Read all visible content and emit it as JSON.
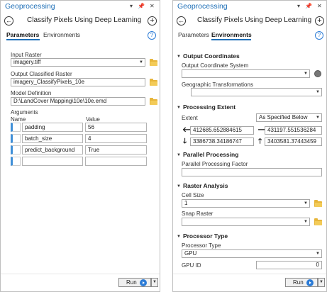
{
  "left": {
    "window": {
      "title": "Geoprocessing",
      "pin": "▾ ⊞ ✕"
    },
    "header": {
      "back": "←",
      "tool_title": "Classify Pixels Using Deep Learning",
      "add": "+"
    },
    "tabs": {
      "parameters": "Parameters",
      "environments": "Environments",
      "help": "?"
    },
    "input_raster": {
      "label": "Input Raster",
      "value": "imagery.tiff"
    },
    "output_raster": {
      "label": "Output Classified Raster",
      "value": "imagery_ClassifyPixels_10e"
    },
    "model_definition": {
      "label": "Model Definition",
      "value": "D:\\LandCover Mapping\\10e\\10e.emd"
    },
    "arguments": {
      "label": "Arguments",
      "col_name": "Name",
      "col_value": "Value",
      "rows": [
        {
          "name": "padding",
          "value": "56"
        },
        {
          "name": "batch_size",
          "value": "4"
        },
        {
          "name": "predict_background",
          "value": "True"
        },
        {
          "name": "",
          "value": ""
        }
      ]
    },
    "run": {
      "label": "Run"
    }
  },
  "right": {
    "window": {
      "title": "Geoprocessing",
      "pin": "▾ ⊞ ✕"
    },
    "header": {
      "back": "←",
      "tool_title": "Classify Pixels Using Deep Learning",
      "add": "+"
    },
    "tabs": {
      "parameters": "Parameters",
      "environments": "Environments",
      "help": "?"
    },
    "output_coordinates": {
      "section": "Output Coordinates",
      "ocs_label": "Output Coordinate System",
      "ocs_value": "",
      "geo_label": "Geographic Transformations",
      "geo_value": ""
    },
    "processing_extent": {
      "section": "Processing Extent",
      "extent_label": "Extent",
      "extent_value": "As Specified Below",
      "left": "412685.652884615",
      "right": "431197.551536284",
      "bottom": "3386738.34186747",
      "top": "3403581.37443459"
    },
    "parallel": {
      "section": "Parallel Processing",
      "factor_label": "Parallel Processing Factor",
      "factor_value": ""
    },
    "raster_analysis": {
      "section": "Raster Analysis",
      "cell_label": "Cell Size",
      "cell_value": "1",
      "snap_label": "Snap Raster",
      "snap_value": ""
    },
    "processor": {
      "section": "Processor Type",
      "type_label": "Processor Type",
      "type_value": "GPU",
      "gpu_label": "GPU ID",
      "gpu_value": "0"
    },
    "run": {
      "label": "Run"
    }
  }
}
